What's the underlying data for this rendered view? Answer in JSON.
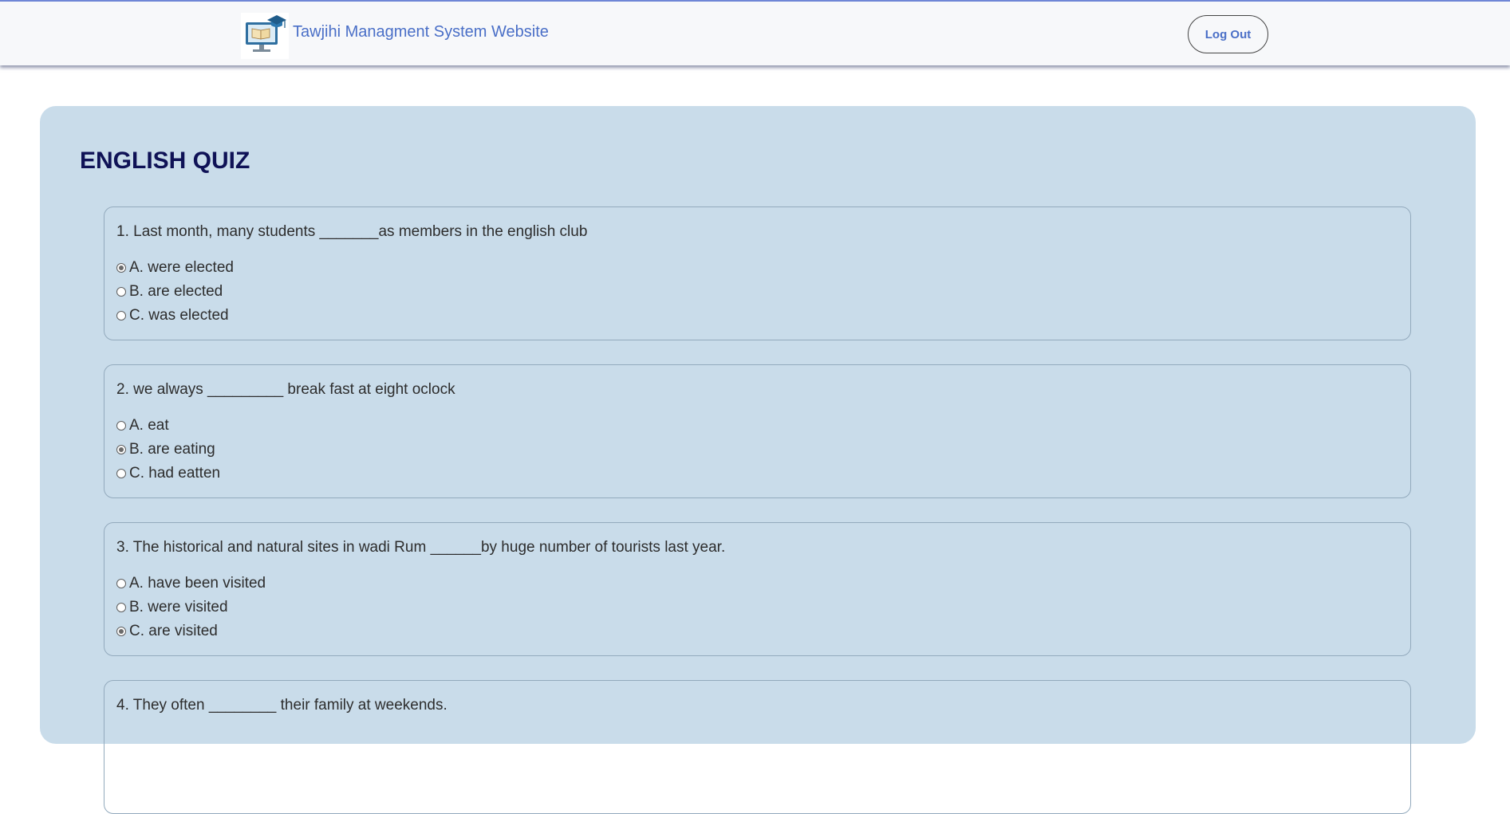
{
  "header": {
    "brand": "Tawjihi Managment System Website",
    "logout_label": "Log Out"
  },
  "quiz": {
    "title": "ENGLISH QUIZ",
    "questions": [
      {
        "text": "1. Last month, many students _______as members in the english club",
        "options": [
          {
            "label": "A. were elected",
            "checked": true
          },
          {
            "label": "B. are elected",
            "checked": false
          },
          {
            "label": "C. was elected",
            "checked": false
          }
        ]
      },
      {
        "text": "2. we always _________ break fast at eight oclock",
        "options": [
          {
            "label": "A. eat",
            "checked": false
          },
          {
            "label": "B. are eating",
            "checked": true
          },
          {
            "label": "C. had eatten",
            "checked": false
          }
        ]
      },
      {
        "text": "3. The historical and natural sites in wadi Rum ______by huge number of tourists last year.",
        "options": [
          {
            "label": "A. have been visited",
            "checked": false
          },
          {
            "label": "B. were visited",
            "checked": false
          },
          {
            "label": "C. are visited",
            "checked": true
          }
        ]
      },
      {
        "text": "4. They often ________ their family at weekends.",
        "options": []
      }
    ]
  },
  "colors": {
    "brand": "#4a6fc7",
    "panel": "#c9dcea",
    "title": "#0f1256"
  }
}
